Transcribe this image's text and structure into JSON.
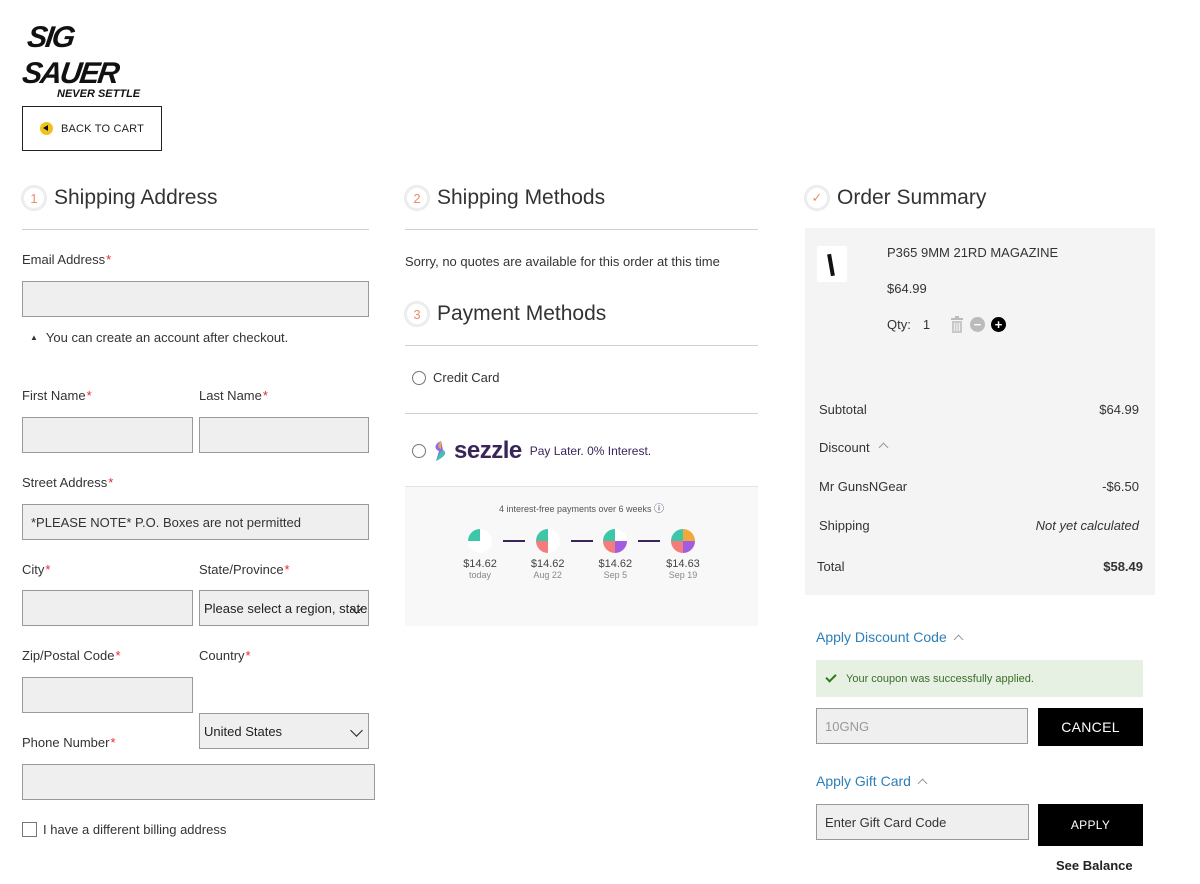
{
  "brand": {
    "name": "SIG SAUER",
    "tagline": "NEVER SETTLE"
  },
  "back_to_cart": "BACK TO CART",
  "shipping_address": {
    "step": "1",
    "title": "Shipping Address",
    "email_label": "Email Address",
    "account_note": "You can create an account after checkout.",
    "first_name_label": "First Name",
    "last_name_label": "Last Name",
    "street_label": "Street Address",
    "street_placeholder": "*PLEASE NOTE* P.O. Boxes are not permitted",
    "city_label": "City",
    "state_label": "State/Province",
    "state_value": "Please select a region, state",
    "zip_label": "Zip/Postal Code",
    "country_label": "Country",
    "country_value": "United States",
    "phone_label": "Phone Number",
    "billing_label": "I have a different billing address",
    "required_mark": "*"
  },
  "shipping_methods": {
    "step": "2",
    "title": "Shipping Methods",
    "message": "Sorry, no quotes are available for this order at this time"
  },
  "payment_methods": {
    "step": "3",
    "title": "Payment Methods",
    "credit_card_label": "Credit Card",
    "sezzle": {
      "word": "sezzle",
      "tagline": "Pay Later. 0% Interest.",
      "info": "4 interest-free payments over 6 weeks",
      "info_icon": "ⓘ",
      "payments": [
        {
          "amount": "$14.62",
          "date": "today"
        },
        {
          "amount": "$14.62",
          "date": "Aug 22"
        },
        {
          "amount": "$14.62",
          "date": "Sep 5"
        },
        {
          "amount": "$14.63",
          "date": "Sep 19"
        }
      ]
    }
  },
  "order_summary": {
    "step": "✓",
    "title": "Order Summary",
    "item": {
      "name": "P365 9MM 21RD MAGAZINE",
      "price": "$64.99",
      "qty_label": "Qty:",
      "qty": "1"
    },
    "subtotal_label": "Subtotal",
    "subtotal": "$64.99",
    "discount_label": "Discount",
    "coupon_name": "Mr GunsNGear",
    "coupon_amount": "-$6.50",
    "shipping_label": "Shipping",
    "shipping_value": "Not yet calculated",
    "total_label": "Total",
    "total": "$58.49"
  },
  "discount_code": {
    "link": "Apply Discount Code",
    "success": "Your coupon was successfully applied.",
    "code_value": "10GNG",
    "cancel_label": "CANCEL"
  },
  "gift_card": {
    "link": "Apply Gift Card",
    "placeholder": "Enter Gift Card Code",
    "apply_label": "APPLY",
    "balance_label": "See Balance"
  },
  "colors": {
    "accent_step": "#f08a6b",
    "link": "#2c7fb8",
    "sezzle": "#392558",
    "success_bg": "#e6f1e3"
  }
}
